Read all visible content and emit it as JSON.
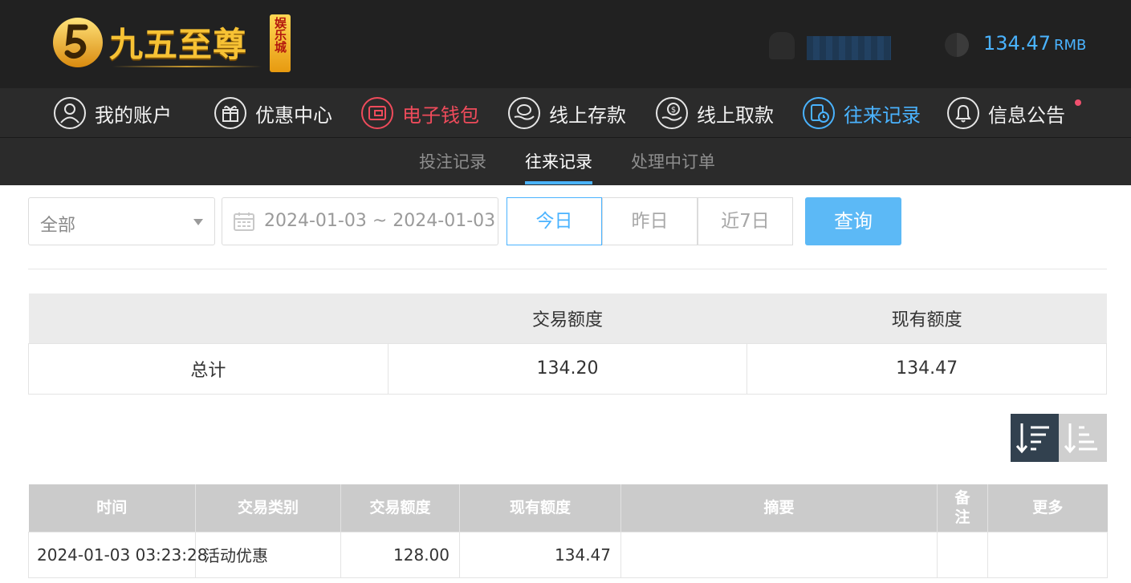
{
  "brand": {
    "name": "九五至尊",
    "badge": "娱乐城"
  },
  "account": {
    "balance": "134.47",
    "currency": "RMB"
  },
  "nav": {
    "items": [
      {
        "label": "我的账户",
        "icon": "user-icon"
      },
      {
        "label": "优惠中心",
        "icon": "gift-icon"
      },
      {
        "label": "电子钱包",
        "icon": "wallet-icon"
      },
      {
        "label": "线上存款",
        "icon": "deposit-icon"
      },
      {
        "label": "线上取款",
        "icon": "withdraw-icon"
      },
      {
        "label": "往来记录",
        "icon": "records-icon",
        "active": true
      },
      {
        "label": "信息公告",
        "icon": "bell-icon"
      }
    ]
  },
  "subnav": {
    "tabs": [
      "投注记录",
      "往来记录",
      "处理中订单"
    ],
    "active": "往来记录"
  },
  "filters": {
    "type_selected": "全部",
    "date_range": "2024-01-03 ~ 2024-01-03",
    "quick": [
      "今日",
      "昨日",
      "近7日"
    ],
    "quick_active": "今日",
    "search_label": "查询"
  },
  "summary": {
    "headers": [
      "",
      "交易额度",
      "现有额度"
    ],
    "row": {
      "label": "总计",
      "transaction": "134.20",
      "current": "134.47"
    }
  },
  "records": {
    "headers": [
      "时间",
      "交易类别",
      "交易额度",
      "现有额度",
      "摘要",
      "备注",
      "更多"
    ],
    "rows": [
      {
        "time": "2024-01-03 03:23:28",
        "type": "活动优惠",
        "amount": "128.00",
        "balance": "134.47",
        "summary": "",
        "note": "",
        "more": ""
      }
    ]
  },
  "colors": {
    "accent": "#4ab3ff",
    "wallet": "#ef4b5b",
    "header_bg": "#212121",
    "nav_bg": "#2b2b2b"
  }
}
